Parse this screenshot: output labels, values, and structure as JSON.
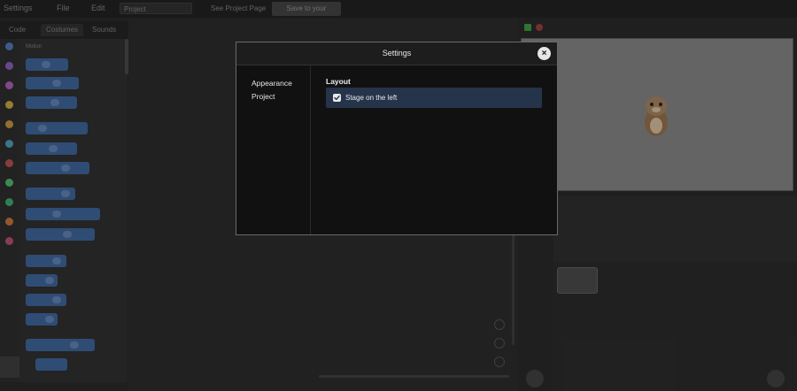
{
  "topbar": {
    "settings_menu": "Settings",
    "file_menu": "File",
    "edit_menu": "Edit",
    "project_title": "Project",
    "see_project_page": "See Project Page",
    "secondary_button": "Save to your Computer"
  },
  "left_tabs": {
    "code": "Code",
    "costumes": "Costumes",
    "sounds": "Sounds"
  },
  "palette": {
    "heading": "Motion"
  },
  "modal": {
    "title": "Settings",
    "close_symbol": "×",
    "nav": [
      {
        "label": "Appearance"
      },
      {
        "label": "Project"
      }
    ],
    "section_title": "Layout",
    "setting": {
      "label": "Stage on the left",
      "checked": true
    }
  },
  "colors": {
    "modal_bg": "#111111",
    "header_bg": "#1d1d1d",
    "selected_row": "#25344b",
    "block_blue": "#3a5d8e",
    "backdrop": "#262626"
  }
}
